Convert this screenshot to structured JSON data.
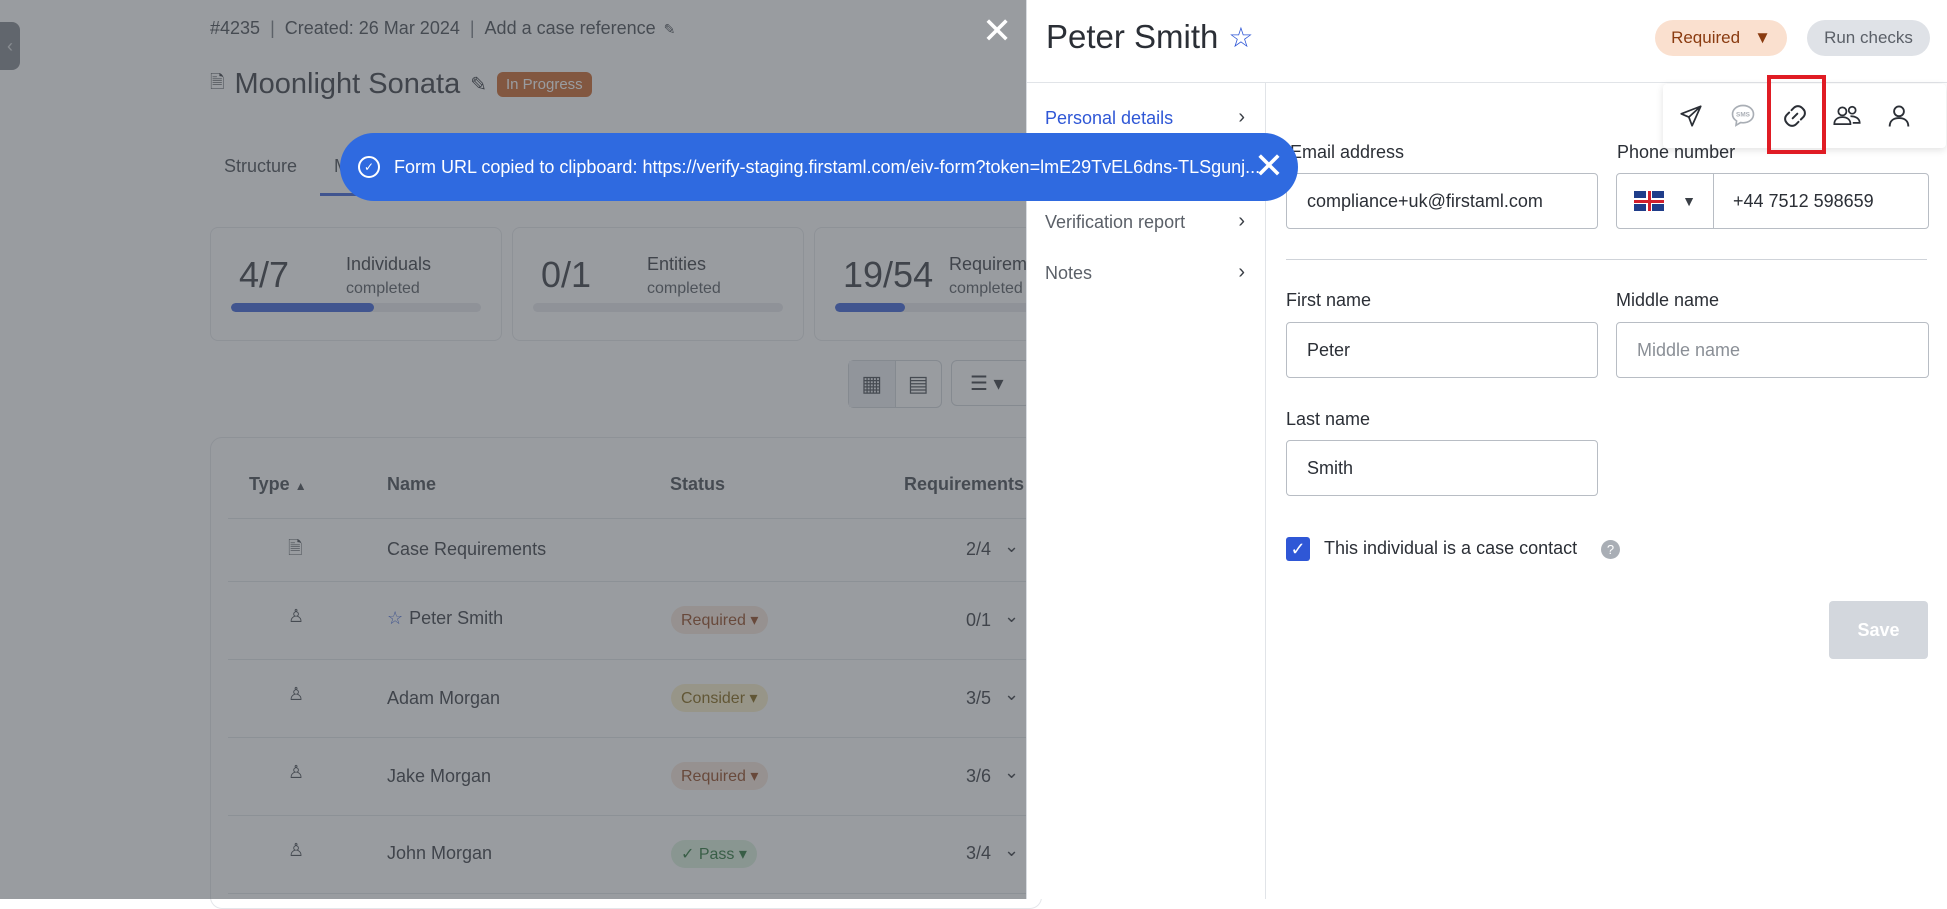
{
  "case": {
    "id": "#4235",
    "created": "Created: 26 Mar 2024",
    "reference_link": "Add a case reference",
    "title": "Moonlight Sonata",
    "status": "In Progress"
  },
  "tabs": [
    "Structure",
    "M"
  ],
  "stats": [
    {
      "big": "4/7",
      "label1": "Individuals",
      "label2": "completed",
      "progress": 0.57
    },
    {
      "big": "0/1",
      "label1": "Entities",
      "label2": "completed",
      "progress": 0.0
    },
    {
      "big": "19/54",
      "label1": "Requirem",
      "label2": "completed",
      "progress": 0.35
    }
  ],
  "table": {
    "headers": {
      "type": "Type",
      "name": "Name",
      "status": "Status",
      "requirements": "Requirements"
    },
    "rows": [
      {
        "icon": "document-icon",
        "name": "Case Requirements",
        "status": "",
        "req": "2/4"
      },
      {
        "icon": "person-icon",
        "name": "Peter Smith",
        "status": "Required",
        "req": "0/1",
        "starred": true
      },
      {
        "icon": "person-icon",
        "name": "Adam Morgan",
        "status": "Consider",
        "req": "3/5"
      },
      {
        "icon": "person-icon",
        "name": "Jake Morgan",
        "status": "Required",
        "req": "3/6"
      },
      {
        "icon": "person-icon",
        "name": "John Morgan",
        "status": "Pass",
        "req": "3/4"
      }
    ]
  },
  "toast": {
    "message": "Form URL copied to clipboard: https://verify-staging.firstaml.com/eiv-form?token=lmE29TvEL6dns-TLSgunj..."
  },
  "panel": {
    "title": "Peter Smith",
    "status_dropdown": "Required",
    "run_checks": "Run checks",
    "nav": [
      "Personal details",
      "Verification report",
      "Notes"
    ],
    "icons": [
      "send-icon",
      "sms-icon",
      "link-icon",
      "people-icon",
      "person-icon"
    ],
    "form": {
      "email_label": "Email address",
      "email_value": "compliance+uk@firstaml.com",
      "phone_label": "Phone number",
      "phone_value": "+44 7512 598659",
      "first_name_label": "First name",
      "first_name_value": "Peter",
      "middle_name_label": "Middle name",
      "middle_name_placeholder": "Middle name",
      "last_name_label": "Last name",
      "last_name_value": "Smith",
      "case_contact_label": "This individual is a case contact",
      "case_contact_checked": true,
      "save_label": "Save"
    }
  },
  "colors": {
    "accent": "#2f57d6",
    "required": "#fae0cf",
    "in_progress": "#c95b1b",
    "highlight": "#e01c24"
  }
}
